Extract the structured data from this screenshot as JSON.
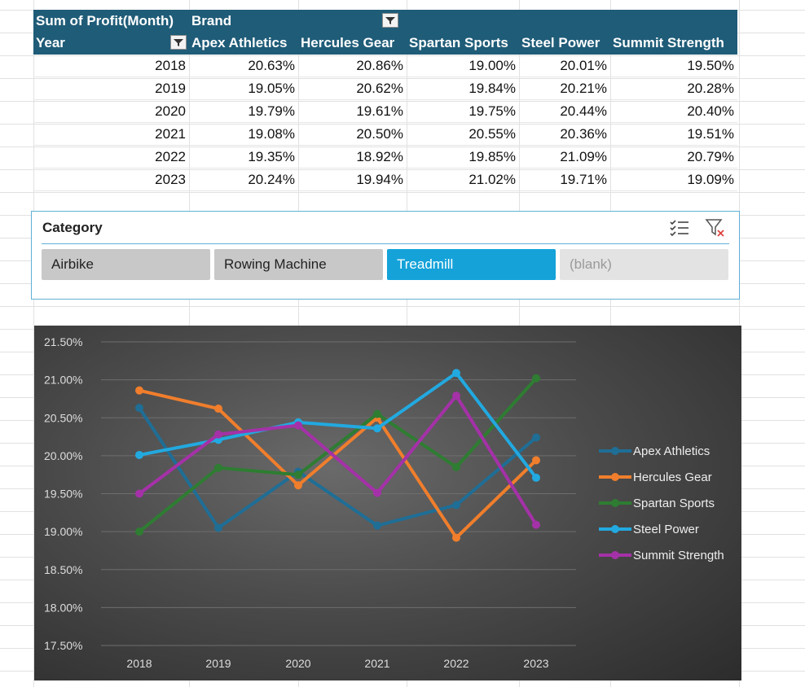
{
  "pivot": {
    "corner_label": "Sum of Profit(Month)",
    "col_field": "Brand",
    "row_field": "Year",
    "columns": [
      "Apex Athletics",
      "Hercules Gear",
      "Spartan Sports",
      "Steel Power",
      "Summit Strength"
    ],
    "rows": [
      {
        "year": "2018",
        "values": [
          "20.63%",
          "20.86%",
          "19.00%",
          "20.01%",
          "19.50%"
        ]
      },
      {
        "year": "2019",
        "values": [
          "19.05%",
          "20.62%",
          "19.84%",
          "20.21%",
          "20.28%"
        ]
      },
      {
        "year": "2020",
        "values": [
          "19.79%",
          "19.61%",
          "19.75%",
          "20.44%",
          "20.40%"
        ]
      },
      {
        "year": "2021",
        "values": [
          "19.08%",
          "20.50%",
          "20.55%",
          "20.36%",
          "19.51%"
        ]
      },
      {
        "year": "2022",
        "values": [
          "19.35%",
          "18.92%",
          "19.85%",
          "21.09%",
          "20.79%"
        ]
      },
      {
        "year": "2023",
        "values": [
          "20.24%",
          "19.94%",
          "21.02%",
          "19.71%",
          "19.09%"
        ]
      }
    ]
  },
  "slicer": {
    "title": "Category",
    "items": [
      {
        "label": "Airbike",
        "state": "off"
      },
      {
        "label": "Rowing Machine",
        "state": "off"
      },
      {
        "label": "Treadmill",
        "state": "on"
      },
      {
        "label": "(blank)",
        "state": "blank"
      }
    ]
  },
  "chart_data": {
    "type": "line",
    "x": [
      "2018",
      "2019",
      "2020",
      "2021",
      "2022",
      "2023"
    ],
    "ylim": [
      17.5,
      21.5
    ],
    "yticks": [
      21.5,
      21.0,
      20.5,
      20.0,
      19.5,
      19.0,
      18.5,
      18.0,
      17.5
    ],
    "ytick_labels": [
      "21.50%",
      "21.00%",
      "20.50%",
      "20.00%",
      "19.50%",
      "19.00%",
      "18.50%",
      "18.00%",
      "17.50%"
    ],
    "grid": true,
    "legend_position": "right",
    "series": [
      {
        "name": "Apex Athletics",
        "color": "#1f6e96",
        "values": [
          20.63,
          19.05,
          19.79,
          19.08,
          19.35,
          20.24
        ]
      },
      {
        "name": "Hercules Gear",
        "color": "#f07e2c",
        "values": [
          20.86,
          20.62,
          19.61,
          20.5,
          18.92,
          19.94
        ]
      },
      {
        "name": "Spartan Sports",
        "color": "#2e7d32",
        "values": [
          19.0,
          19.84,
          19.75,
          20.55,
          19.85,
          21.02
        ]
      },
      {
        "name": "Steel Power",
        "color": "#22a9e0",
        "values": [
          20.01,
          20.21,
          20.44,
          20.36,
          21.09,
          19.71
        ]
      },
      {
        "name": "Summit Strength",
        "color": "#a531a8",
        "values": [
          19.5,
          20.28,
          20.4,
          19.51,
          20.79,
          19.09
        ]
      }
    ]
  }
}
